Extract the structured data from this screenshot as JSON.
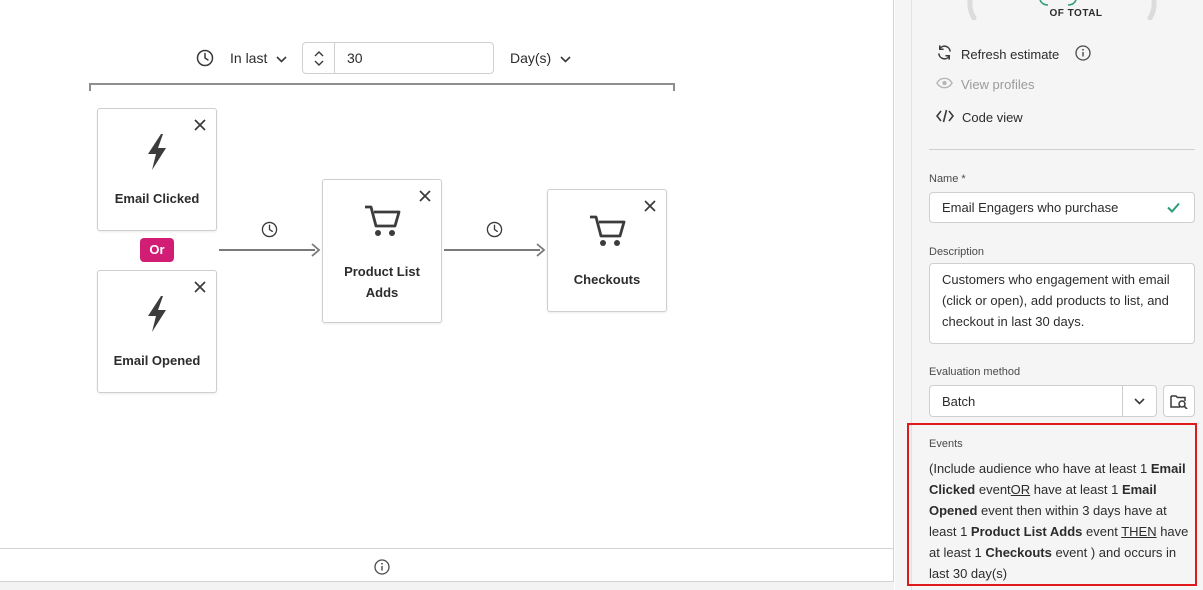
{
  "gauge": {
    "caption": "OF TOTAL"
  },
  "actions": {
    "refresh_label": "Refresh estimate",
    "view_profiles_label": "View profiles",
    "code_view_label": "Code view"
  },
  "time_constraint": {
    "mode": "In last",
    "value": "30",
    "unit": "Day(s)"
  },
  "nodes": {
    "email_clicked": "Email Clicked",
    "or_label": "Or",
    "email_opened": "Email Opened",
    "product_list_adds_line1": "Product List",
    "product_list_adds_line2": "Adds",
    "checkouts": "Checkouts"
  },
  "form": {
    "name_label": "Name *",
    "name_value": "Email Engagers who purchase",
    "description_label": "Description",
    "description_value": "Customers who engagement with email (click or open), add products to list, and checkout in last 30 days.",
    "evaluation_label": "Evaluation method",
    "evaluation_value": "Batch"
  },
  "events": {
    "label": "Events",
    "t1": "(Include audience who have at least 1 ",
    "b1": "Email Clicked",
    "t2": " event",
    "op1": "OR",
    "t3": " have at least 1 ",
    "b2": "Email Opened",
    "t4": " event then within 3 days have at least 1 ",
    "b3": "Product List Adds",
    "t5": " event ",
    "op2": "THEN",
    "t6": " have at least 1 ",
    "b4": "Checkouts",
    "t7": " event ) and occurs in last 30 day(s)"
  },
  "colors": {
    "or_badge": "#d11e74",
    "highlight_border": "#e0191c",
    "check": "#2d9d78"
  },
  "icons": [
    "clock-icon",
    "chevron-down-icon",
    "stepper-icon",
    "close-icon",
    "lightning-icon",
    "cart-icon",
    "refresh-icon",
    "info-icon",
    "eye-icon",
    "code-icon",
    "checkmark-icon",
    "folder-search-icon"
  ]
}
